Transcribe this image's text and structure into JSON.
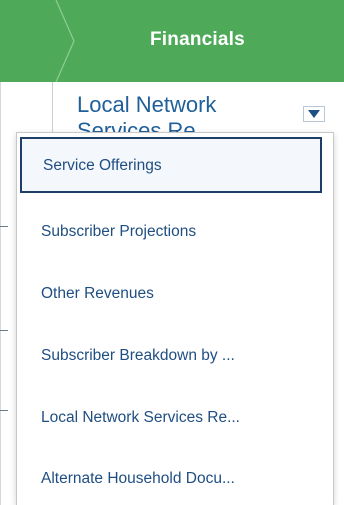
{
  "header": {
    "title": "Financials",
    "background_color": "#4eaa58"
  },
  "section_select": {
    "selected_value": "Local Network Services Re",
    "text_color": "#1f5f9a"
  },
  "dropdown": {
    "active_index": 0,
    "items": [
      {
        "label": "Service Offerings"
      },
      {
        "label": "Subscriber Projections"
      },
      {
        "label": "Other Revenues"
      },
      {
        "label": "Subscriber Breakdown by ..."
      },
      {
        "label": "Local Network Services Re..."
      },
      {
        "label": "Alternate Household Docu..."
      }
    ],
    "text_color": "#1f4e82",
    "active_border_color": "#1d3f67"
  }
}
